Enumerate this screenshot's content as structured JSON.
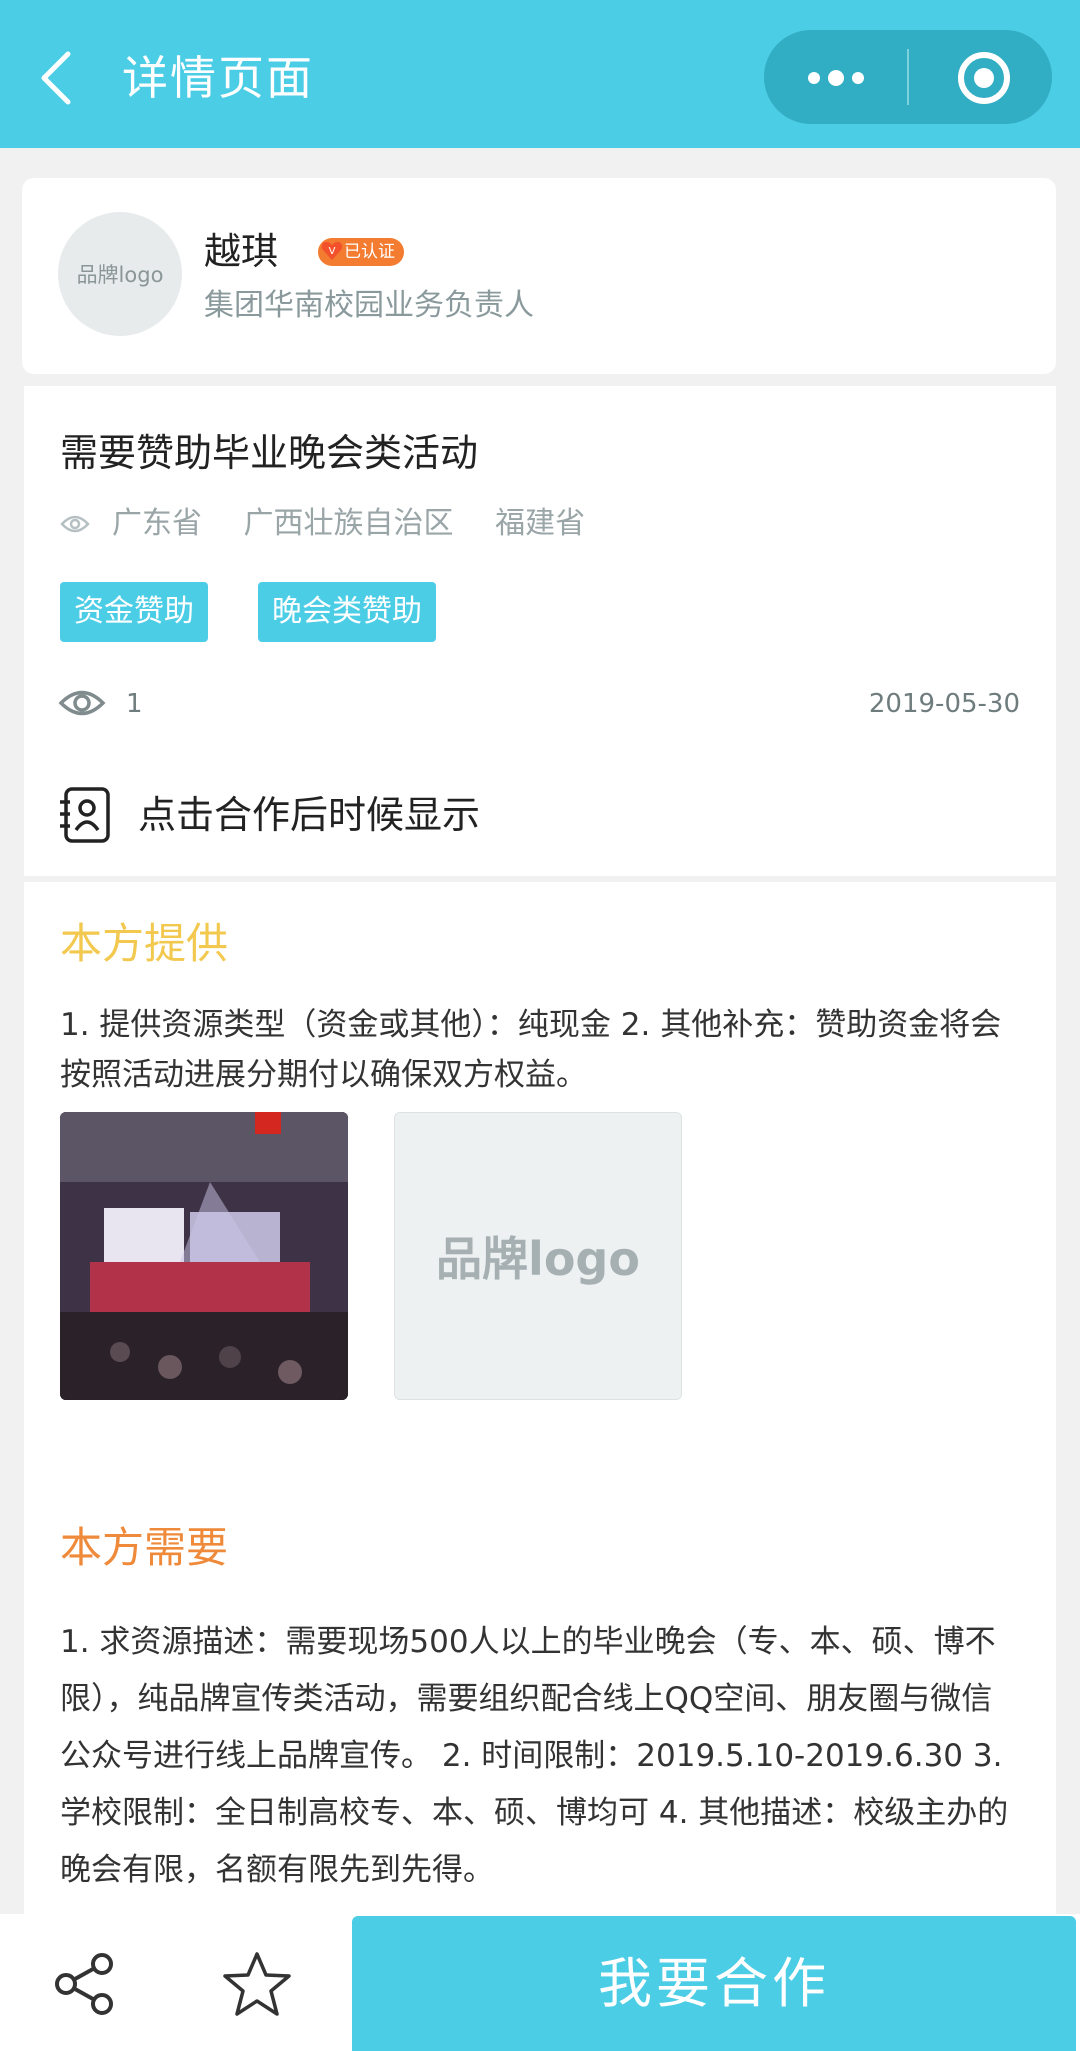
{
  "header": {
    "title": "详情页面",
    "icons": {
      "back": "chevron-left-icon",
      "more": "more-dots-icon",
      "target": "target-icon"
    },
    "bar_color": "#4ccde6"
  },
  "profile": {
    "avatar_text": "品牌logo",
    "name": "越琪",
    "badge": "已认证",
    "role": "集团华南校园业务负责人"
  },
  "request": {
    "title": "需要赞助毕业晚会类活动",
    "regions": [
      "广东省",
      "广西壮族自治区",
      "福建省"
    ],
    "tags": [
      "资金赞助",
      "晚会类赞助"
    ],
    "views": "1",
    "date": "2019-05-30",
    "contact_hint": "点击合作后时候显示"
  },
  "offer": {
    "title": "本方提供",
    "text": "1. 提供资源类型（资金或其他）：纯现金 2. 其他补充：赞助资金将会按照活动进展分期付以确保双方权益。",
    "image_placeholder_text": "品牌logo"
  },
  "need": {
    "title": "本方需要",
    "text": "1. 求资源描述：需要现场500人以上的毕业晚会（专、本、硕、博不限），纯品牌宣传类活动，需要组织配合线上QQ空间、朋友圈与微信公众号进行线上品牌宣传。 2. 时间限制：2019.5.10-2019.6.30 3. 学校限制：全日制高校专、本、硕、博均可 4. 其他描述：校级主办的晚会有限，名额有限先到先得。"
  },
  "bottom": {
    "cooperate_label": "我要合作",
    "icons": {
      "share": "share-icon",
      "favorite": "star-icon"
    }
  },
  "colors": {
    "accent": "#4ccde6",
    "offer_title": "#f2c84e",
    "need_title": "#ef8a3a",
    "badge": "#f37c31"
  }
}
